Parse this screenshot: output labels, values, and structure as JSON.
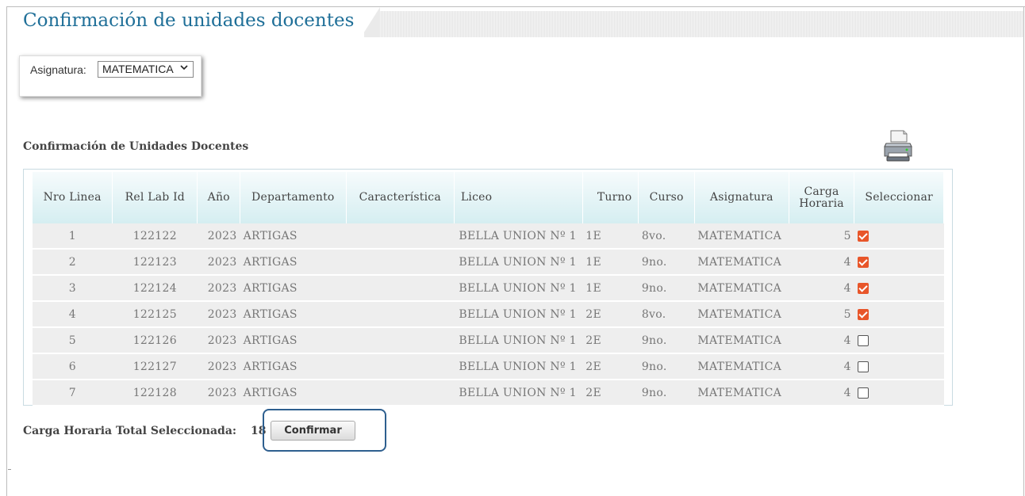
{
  "page": {
    "title": "Confirmación de unidades docentes"
  },
  "filter": {
    "label": "Asignatura:",
    "selected": "MATEMATICA"
  },
  "section": {
    "title": "Confirmación de Unidades Docentes"
  },
  "table": {
    "headers": {
      "nro_linea": "Nro Linea",
      "rel_lab_id": "Rel Lab Id",
      "anio": "Año",
      "departamento": "Departamento",
      "caracteristica": "Característica",
      "liceo": "Liceo",
      "turno": "Turno",
      "curso": "Curso",
      "asignatura": "Asignatura",
      "carga_horaria": "Carga Horaria",
      "seleccionar": "Seleccionar"
    },
    "rows": [
      {
        "nro": "1",
        "rel": "122122",
        "anio": "2023",
        "dep": "ARTIGAS",
        "car": "",
        "liceo": "BELLA UNION Nº 1",
        "turno": "1E",
        "curso": "8vo.",
        "asig": "MATEMATICA",
        "carga": "5",
        "selected": true
      },
      {
        "nro": "2",
        "rel": "122123",
        "anio": "2023",
        "dep": "ARTIGAS",
        "car": "",
        "liceo": "BELLA UNION Nº 1",
        "turno": "1E",
        "curso": "9no.",
        "asig": "MATEMATICA",
        "carga": "4",
        "selected": true
      },
      {
        "nro": "3",
        "rel": "122124",
        "anio": "2023",
        "dep": "ARTIGAS",
        "car": "",
        "liceo": "BELLA UNION Nº 1",
        "turno": "1E",
        "curso": "9no.",
        "asig": "MATEMATICA",
        "carga": "4",
        "selected": true
      },
      {
        "nro": "4",
        "rel": "122125",
        "anio": "2023",
        "dep": "ARTIGAS",
        "car": "",
        "liceo": "BELLA UNION Nº 1",
        "turno": "2E",
        "curso": "8vo.",
        "asig": "MATEMATICA",
        "carga": "5",
        "selected": true
      },
      {
        "nro": "5",
        "rel": "122126",
        "anio": "2023",
        "dep": "ARTIGAS",
        "car": "",
        "liceo": "BELLA UNION Nº 1",
        "turno": "2E",
        "curso": "9no.",
        "asig": "MATEMATICA",
        "carga": "4",
        "selected": false
      },
      {
        "nro": "6",
        "rel": "122127",
        "anio": "2023",
        "dep": "ARTIGAS",
        "car": "",
        "liceo": "BELLA UNION Nº 1",
        "turno": "2E",
        "curso": "9no.",
        "asig": "MATEMATICA",
        "carga": "4",
        "selected": false
      },
      {
        "nro": "7",
        "rel": "122128",
        "anio": "2023",
        "dep": "ARTIGAS",
        "car": "",
        "liceo": "BELLA UNION Nº 1",
        "turno": "2E",
        "curso": "9no.",
        "asig": "MATEMATICA",
        "carga": "4",
        "selected": false
      }
    ]
  },
  "footer": {
    "total_label": "Carga Horaria Total Seleccionada:",
    "total_value": "18",
    "confirm_label": "Confirmar"
  },
  "colors": {
    "title": "#1f6f98",
    "checkbox_on": "#e8562a",
    "highlight": "#2e5f8f"
  },
  "icons": {
    "print": "printer-icon",
    "select": "chevron-down-icon"
  }
}
